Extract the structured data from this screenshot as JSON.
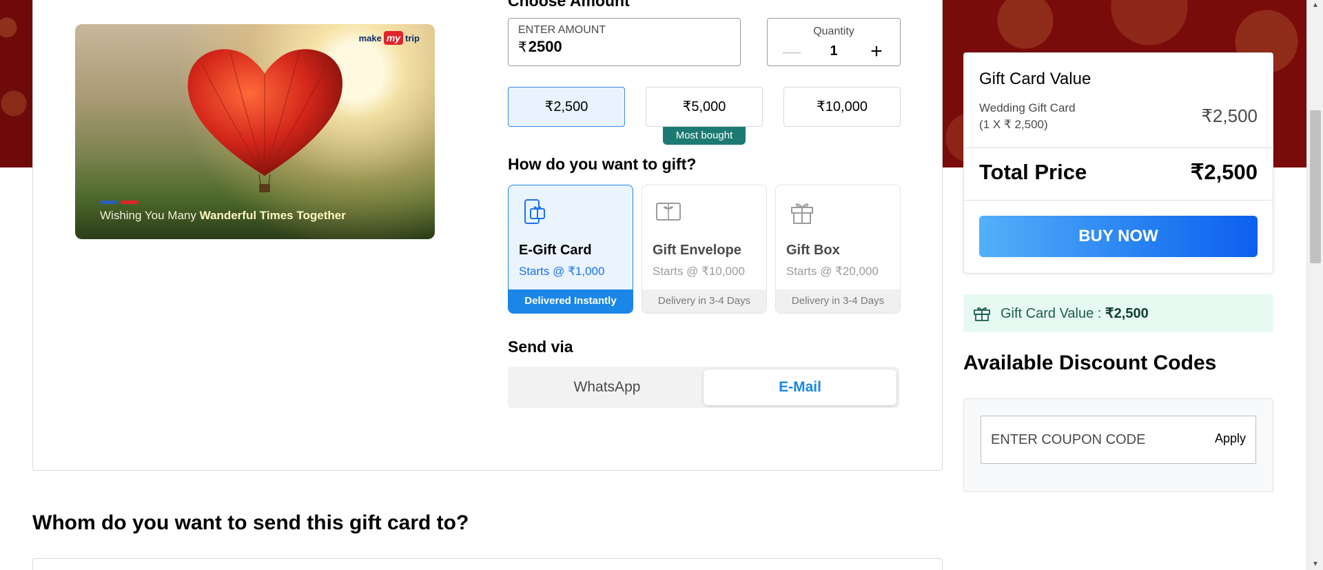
{
  "colors": {
    "brand_blue": "#1a86e8",
    "selected_bg": "#eaf4ff",
    "most_bought_bg": "#1c7a72",
    "maroon": "#7a0b0b",
    "gift_value_bg": "#e7faf2"
  },
  "card": {
    "logo_make": "make",
    "logo_my": "my",
    "logo_trip": "trip",
    "caption_prefix": "Wishing You Many ",
    "caption_bold": "Wanderful Times Together"
  },
  "amount": {
    "section_title": "Choose Amount",
    "label": "ENTER AMOUNT",
    "currency": "₹",
    "value": "2500"
  },
  "quantity": {
    "label": "Quantity",
    "minus": "—",
    "value": "1",
    "plus": "+"
  },
  "amount_options": [
    {
      "label": "₹2,500",
      "selected": true
    },
    {
      "label": "₹5,000",
      "selected": false,
      "badge": "Most bought"
    },
    {
      "label": "₹10,000",
      "selected": false
    }
  ],
  "gift_method": {
    "title": "How do you want to gift?",
    "options": [
      {
        "title": "E-Gift Card",
        "subtitle": "Starts @ ₹1,000",
        "footer": "Delivered Instantly",
        "icon": "phone-gift-icon",
        "selected": true
      },
      {
        "title": "Gift Envelope",
        "subtitle": "Starts @ ₹10,000",
        "footer": "Delivery in 3-4 Days",
        "icon": "envelope-icon",
        "selected": false
      },
      {
        "title": "Gift Box",
        "subtitle": "Starts @ ₹20,000",
        "footer": "Delivery in 3-4 Days",
        "icon": "gift-box-icon",
        "selected": false
      }
    ]
  },
  "send_via": {
    "title": "Send via",
    "options": [
      {
        "label": "WhatsApp",
        "active": false
      },
      {
        "label": "E-Mail",
        "active": true
      }
    ]
  },
  "recipient": {
    "title": "Whom do you want to send this gift card to?"
  },
  "summary": {
    "title": "Gift Card Value",
    "item_name": "Wedding Gift Card",
    "item_detail": "(1 X ₹ 2,500)",
    "item_price": "₹2,500",
    "total_label": "Total Price",
    "total_price": "₹2,500",
    "buy_label": "BUY NOW"
  },
  "gift_value_bar": {
    "label": "Gift Card Value : ",
    "value": "₹2,500"
  },
  "discount": {
    "title": "Available Discount Codes",
    "placeholder": "ENTER COUPON CODE",
    "apply_label": "Apply"
  }
}
